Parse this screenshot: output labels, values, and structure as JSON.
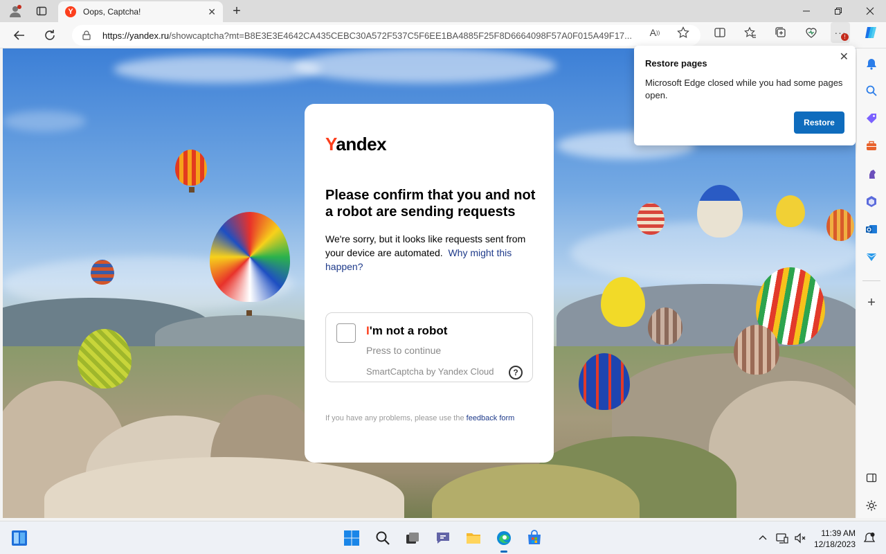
{
  "browser": {
    "tab_title": "Oops, Captcha!",
    "tab_favicon_letter": "Y",
    "url_host": "https://yandex.ru",
    "url_path": "/showcaptcha?mt=B8E3E3E4642CA435CEBC30A572F537C5F6EE1BA4885F25F8D6664098F57A0F015A49F17...",
    "more_badge": "!"
  },
  "captcha_page": {
    "logo_first": "Y",
    "logo_rest": "andex",
    "headline": "Please confirm that you and not a robot are sending requests",
    "desc_text": "We're sorry, but it looks like requests sent from your device are automated.",
    "desc_link": "Why might this happen?",
    "robot_label_first": "I",
    "robot_label_rest": "'m not a robot",
    "press_text": "Press to continue",
    "provider": "SmartCaptcha by Yandex Cloud",
    "help_glyph": "?",
    "footnote_text": "If you have any problems, please use the",
    "footnote_link": "feedback form"
  },
  "restore_popup": {
    "title": "Restore pages",
    "message": "Microsoft Edge closed while you had some pages open.",
    "button": "Restore"
  },
  "taskbar": {
    "time": "11:39 AM",
    "date": "12/18/2023"
  },
  "colors": {
    "yandex_red": "#fc3f1d",
    "link_blue": "#1e3a8a",
    "edge_blue": "#0f6cbd"
  }
}
